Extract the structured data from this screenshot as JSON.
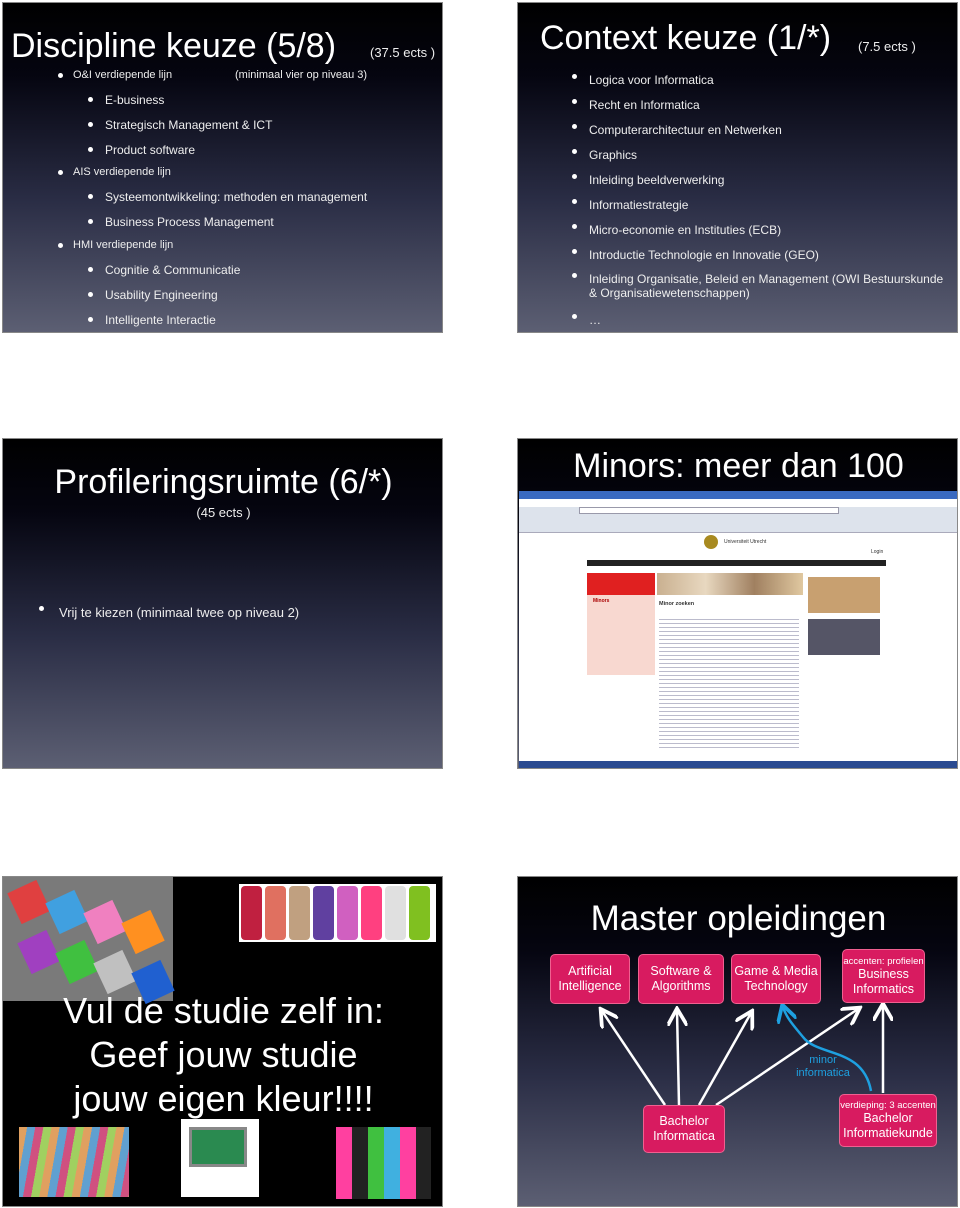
{
  "slide1": {
    "title": "Discipline keuze (5/8)",
    "ects": "(37.5 ects )",
    "note": "(minimaal vier op niveau 3)",
    "items": [
      {
        "level": 1,
        "text": "O&I verdiepende lijn"
      },
      {
        "level": 2,
        "text": "E-business"
      },
      {
        "level": 2,
        "text": "Strategisch Management & ICT"
      },
      {
        "level": 2,
        "text": "Product software"
      },
      {
        "level": 1,
        "text": "AIS verdiepende lijn"
      },
      {
        "level": 2,
        "text": "Systeemontwikkeling: methoden en management"
      },
      {
        "level": 2,
        "text": "Business Process Management"
      },
      {
        "level": 1,
        "text": "HMI verdiepende lijn"
      },
      {
        "level": 2,
        "text": "Cognitie & Communicatie"
      },
      {
        "level": 2,
        "text": "Usability Engineering"
      },
      {
        "level": 2,
        "text": "Intelligente Interactie"
      }
    ]
  },
  "slide2": {
    "title": "Context keuze (1/*)",
    "ects": "(7.5 ects )",
    "items": [
      "Logica voor Informatica",
      "Recht en Informatica",
      "Computerarchitectuur en Netwerken",
      "Graphics",
      "Inleiding beeldverwerking",
      "Informatiestrategie",
      "Micro-economie en Instituties (ECB)",
      "Introductie Technologie en Innovatie (GEO)",
      "Inleiding Organisatie, Beleid en Management (OWI Bestuurskunde",
      "& Organisatiewetenschappen)",
      "…"
    ]
  },
  "slide3": {
    "title": "Profileringsruimte (6/*)",
    "ects": "(45 ects )",
    "bullet": "Vrij te kiezen (minimaal twee op niveau 2)"
  },
  "slide4": {
    "title": "Minors: meer dan 100",
    "browser": {
      "page_heading": "Minor zoeken",
      "university": "Universiteit Utrecht",
      "login": "Login",
      "menu_heading": "Minors"
    }
  },
  "slide5": {
    "lines": [
      "Vul de studie zelf in:",
      "Geef jouw studie",
      "jouw eigen kleur!!!!"
    ]
  },
  "slide6": {
    "title": "Master opleidingen",
    "masters": [
      {
        "label": "Artificial Intelligence"
      },
      {
        "label": "Software & Algorithms"
      },
      {
        "label": "Game & Media Technology"
      },
      {
        "note": "accenten: profielen",
        "label": "Business Informatics"
      }
    ],
    "bachelors": [
      {
        "label": "Bachelor Informatica"
      },
      {
        "note": "verdieping: 3 accenten",
        "label": "Bachelor Informatiekunde"
      }
    ],
    "minor_label": "minor informatica",
    "colors": {
      "box": "#d81b60",
      "minor_arrow": "#1ea0e0"
    }
  }
}
